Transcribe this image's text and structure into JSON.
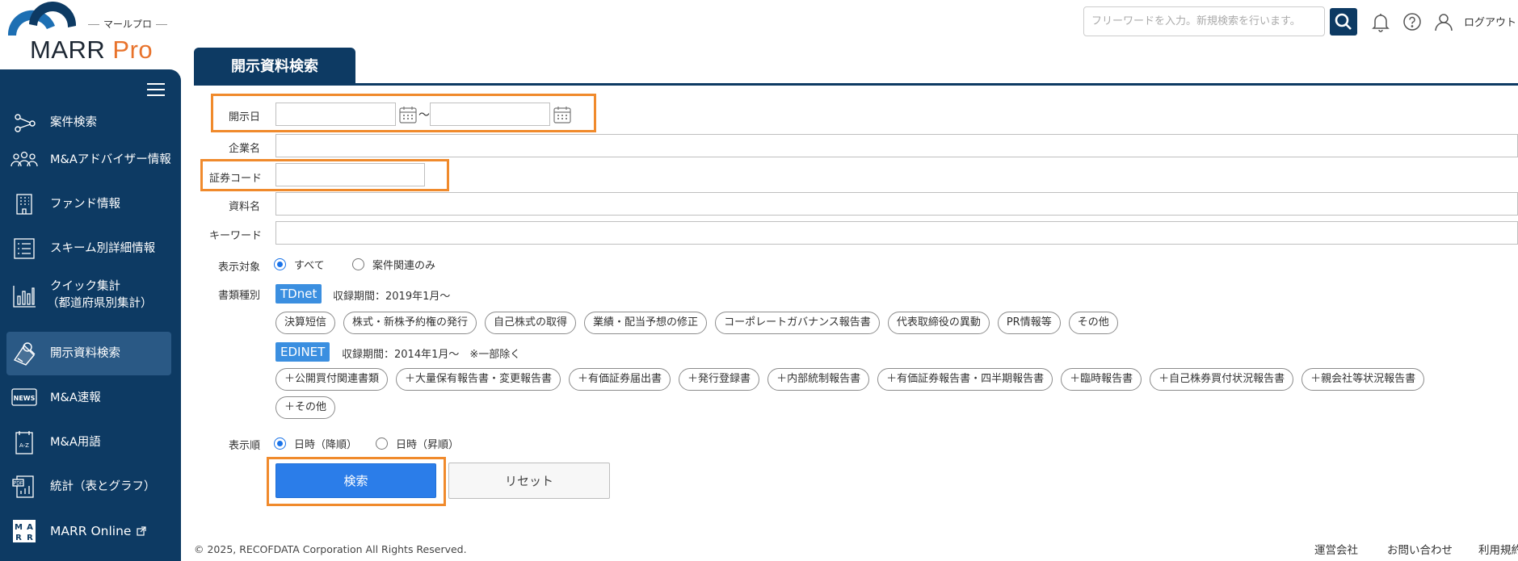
{
  "brand": {
    "subtitle": "マールプロ",
    "name": "MARR",
    "name_suffix": "Pro",
    "accent_color": "#e8732c",
    "navy_color": "#0d3a63"
  },
  "header": {
    "search_placeholder": "フリーワードを入力。新規検索を行います。",
    "search_icon": "search-icon",
    "logout": "ログアウト"
  },
  "sidebar": {
    "items": [
      {
        "label": "案件検索",
        "icon": "nodes-icon"
      },
      {
        "label": "M&Aアドバイザー情報",
        "icon": "people-icon"
      },
      {
        "label": "ファンド情報",
        "icon": "building-icon"
      },
      {
        "label": "スキーム別詳細情報",
        "icon": "list-icon"
      },
      {
        "label": "クイック集計",
        "label2": "（都道府県別集計）",
        "icon": "bar-chart-icon"
      },
      {
        "label": "開示資料検索",
        "icon": "document-search-icon",
        "active": true
      },
      {
        "label": "M&A速報",
        "icon": "news-icon"
      },
      {
        "label": "M&A用語",
        "icon": "glossary-icon"
      },
      {
        "label": "統計（表とグラフ）",
        "icon": "pdf-chart-icon"
      },
      {
        "label": "MARR Online",
        "icon": "marr-icon",
        "external_icon": "external-link-icon"
      }
    ]
  },
  "page": {
    "title": "開示資料検索"
  },
  "form": {
    "date_label": "開示日",
    "date_from": "",
    "date_to": "",
    "date_sep": "～",
    "company_label": "企業名",
    "company_value": "",
    "code_label": "証券コード",
    "code_value": "",
    "doc_label": "資料名",
    "doc_value": "",
    "keyword_label": "キーワード",
    "keyword_value": "",
    "target_label": "表示対象",
    "target_options": [
      "すべて",
      "案件関連のみ"
    ],
    "target_selected": 0,
    "type_label": "書類種別",
    "tdnet": {
      "badge": "TDnet",
      "period": "収録期間：2019年1月～",
      "chips": [
        "決算短信",
        "株式・新株予約権の発行",
        "自己株式の取得",
        "業績・配当予想の修正",
        "コーポレートガバナンス報告書",
        "代表取締役の異動",
        "PR情報等",
        "その他"
      ]
    },
    "edinet": {
      "badge": "EDINET",
      "period": "収録期間：2014年1月～　※一部除く",
      "chips_row1": [
        "＋公開買付関連書類",
        "＋大量保有報告書・変更報告書",
        "＋有価証券届出書",
        "＋発行登録書",
        "＋内部統制報告書",
        "＋有価証券報告書・四半期報告書",
        "＋臨時報告書",
        "＋自己株券買付状況報告書",
        "＋親会社等状況報告書"
      ],
      "chips_row2": [
        "＋その他"
      ]
    },
    "order_label": "表示順",
    "order_options": [
      "日時（降順）",
      "日時（昇順）"
    ],
    "order_selected": 0,
    "search_button": "検索",
    "reset_button": "リセット",
    "highlight_color": "#f08a2c"
  },
  "footer": {
    "copyright": "© 2025, RECOFDATA Corporation All Rights Reserved.",
    "links": [
      "運営会社",
      "お問い合わせ",
      "利用規約"
    ]
  }
}
